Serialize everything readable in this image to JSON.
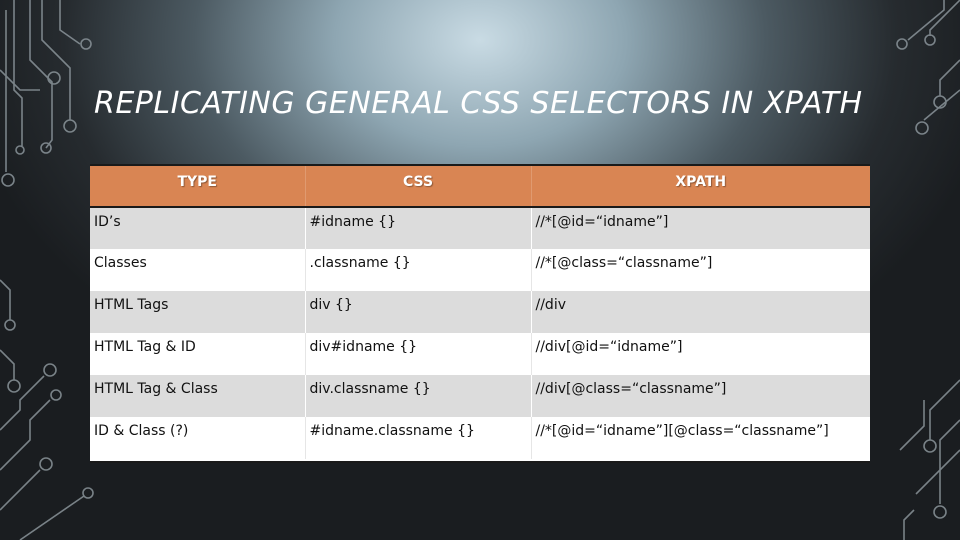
{
  "slide": {
    "title": "REPLICATING GENERAL CSS SELECTORS IN XPATH"
  },
  "table": {
    "headers": [
      "TYPE",
      "CSS",
      "XPATH"
    ],
    "rows": [
      [
        "ID’s",
        "#idname {}",
        "//*[@id=“idname”]"
      ],
      [
        "Classes",
        ".classname {}",
        "//*[@class=“classname”]"
      ],
      [
        "HTML Tags",
        "div {}",
        "//div"
      ],
      [
        "HTML Tag & ID",
        "div#idname {}",
        "//div[@id=“idname”]"
      ],
      [
        "HTML Tag & Class",
        "div.classname {}",
        "//div[@class=“classname”]"
      ],
      [
        "ID & Class (?)",
        "#idname.classname {}",
        "//*[@id=“idname”][@class=“classname”]"
      ]
    ]
  },
  "colors": {
    "header_bg": "#d98553",
    "row_alt_bg": "#dcdcdc",
    "title_color": "#ffffff",
    "circuit_color": "#8a949a"
  },
  "decoration": {
    "icon": "circuit-lines-icon"
  }
}
